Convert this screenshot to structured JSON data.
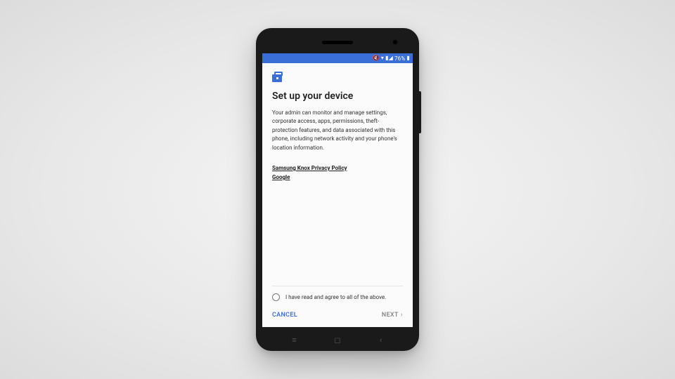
{
  "statusbar": {
    "battery_pct": "76%"
  },
  "screen": {
    "title": "Set up your device",
    "body": "Your admin can monitor and manage settings, corporate access, apps, permissions, theft-protection features, and data associated with this phone, including network activity and your phone's location information.",
    "links": {
      "knox": "Samsung Knox Privacy Policy",
      "google": "Google"
    },
    "agree_label": "I have read and agree to all of the above."
  },
  "footer": {
    "cancel": "CANCEL",
    "next": "NEXT"
  }
}
